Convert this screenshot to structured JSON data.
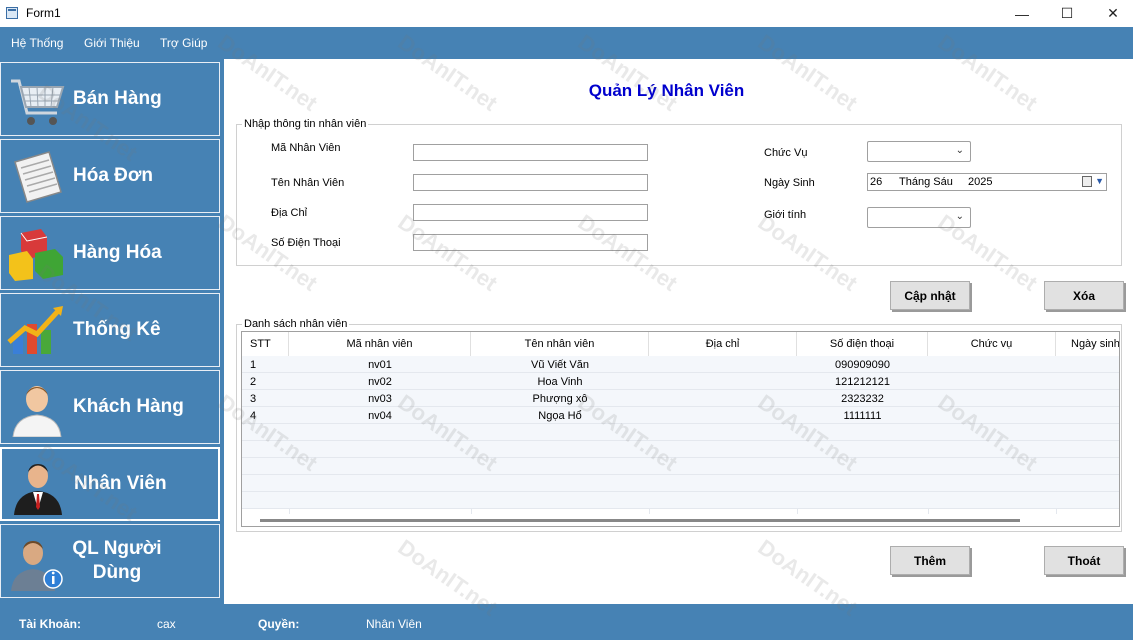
{
  "window": {
    "title": "Form1",
    "controls": {
      "minimize": "—",
      "maximize": "☐",
      "close": "✕"
    }
  },
  "menu": {
    "items": [
      "Hệ Thống",
      "Giới Thiệu",
      "Trợ Giúp"
    ]
  },
  "sidebar": {
    "items": [
      {
        "label": "Bán Hàng",
        "icon": "shopping-cart-icon"
      },
      {
        "label": "Hóa Đơn",
        "icon": "invoice-icon"
      },
      {
        "label": "Hàng Hóa",
        "icon": "boxes-icon"
      },
      {
        "label": "Thống Kê",
        "icon": "chart-icon"
      },
      {
        "label": "Khách Hàng",
        "icon": "customer-icon"
      },
      {
        "label": "Nhân Viên",
        "icon": "employee-icon"
      },
      {
        "label_line1": "QL Người",
        "label_line2": "Dùng",
        "icon": "user-admin-icon"
      }
    ],
    "active_index": 5
  },
  "page": {
    "title": "Quản Lý Nhân Viên"
  },
  "form": {
    "group_title": "Nhập thông tin nhân viên",
    "ma_nv_label": "Mã Nhân Viên",
    "ten_nv_label": "Tên Nhân Viên",
    "dia_chi_label": "Địa Chỉ",
    "sdt_label": "Số Điện Thoại",
    "chuc_vu_label": "Chức Vụ",
    "ngay_sinh_label": "Ngày Sinh",
    "gioi_tinh_label": "Giới tính",
    "ma_nv_value": "",
    "ten_nv_value": "",
    "dia_chi_value": "",
    "sdt_value": "",
    "chuc_vu_value": "",
    "gioi_tinh_value": "",
    "ngay_sinh": {
      "day": "26",
      "month": "Tháng Sáu",
      "year": "2025"
    }
  },
  "buttons": {
    "update": "Cập nhật",
    "delete": "Xóa",
    "add": "Thêm",
    "exit": "Thoát"
  },
  "table": {
    "group_title": "Danh sách nhân viên",
    "columns": [
      "STT",
      "Mã nhân viên",
      "Tên nhân viên",
      "Địa chỉ",
      "Số điện thoại",
      "Chức vụ",
      "Ngày sinh"
    ],
    "rows": [
      [
        "1",
        "nv01",
        "Vũ Viết Văn",
        "",
        "090909090",
        "",
        ""
      ],
      [
        "2",
        "nv02",
        "Hoa Vinh",
        "",
        "121212121",
        "",
        ""
      ],
      [
        "3",
        "nv03",
        "Phượng xô",
        "",
        "2323232",
        "",
        ""
      ],
      [
        "4",
        "nv04",
        "Ngọa Hổ",
        "",
        "1111111",
        "",
        ""
      ]
    ]
  },
  "status": {
    "account_label": "Tài Khoản:",
    "account_value": "cax",
    "role_label": "Quyền:",
    "role_value": "Nhân Viên"
  },
  "watermark": "DoAnIT.net",
  "colors": {
    "accent": "#4682b4",
    "title": "#0000cd"
  }
}
